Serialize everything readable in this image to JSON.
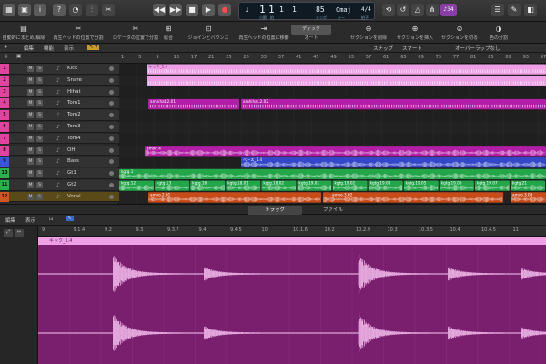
{
  "toolbar": {
    "lcd": {
      "bar": "1",
      "beat": "1",
      "div": "1",
      "tick": "1",
      "tempo": "85",
      "key": "Cmaj",
      "signature": "4/4",
      "labels": [
        "小節",
        "拍",
        "テンポ",
        "キー",
        "拍子"
      ]
    },
    "tuner_badge": "♪34",
    "icons": [
      "library-icon",
      "inbox-icon",
      "info-icon",
      "help-icon",
      "smart-controls-icon",
      "mixer-icon",
      "scissors-icon",
      "rewind-icon",
      "fast-forward-icon",
      "stop-icon",
      "play-icon",
      "record-icon",
      "cycle-icon",
      "undo-icon",
      "metronome-icon",
      "tuner-icon",
      "badge",
      "list-editor-icon",
      "notepad-icon",
      "browser-icon"
    ]
  },
  "controlbar": {
    "items": [
      "自動的にまとめ/解除",
      "再生ヘッドの位置で分割",
      "ロケータの位置で分割",
      "結合",
      "ジョインとバウンス",
      "再生ヘッドの位置に移動",
      "ディック",
      "オート",
      "セクションを削除",
      "セクションを挿入",
      "セクションを切る",
      "色の分割"
    ],
    "dropdown": "ディック"
  },
  "header": {
    "edit": "編集",
    "function": "機能",
    "view": "表示",
    "snap": "スナップ",
    "smart": "スマート",
    "overlap": "オーバーラップなし"
  },
  "tracks": [
    {
      "num": "1",
      "name": "Kick",
      "color": "#e0449e"
    },
    {
      "num": "2",
      "name": "Snare",
      "color": "#e0449e"
    },
    {
      "num": "3",
      "name": "Hihat",
      "color": "#e0449e"
    },
    {
      "num": "4",
      "name": "Tom1",
      "color": "#e0449e"
    },
    {
      "num": "5",
      "name": "Tom2",
      "color": "#e0449e"
    },
    {
      "num": "6",
      "name": "Tom3",
      "color": "#e0449e"
    },
    {
      "num": "7",
      "name": "Tom4",
      "color": "#e0449e"
    },
    {
      "num": "8",
      "name": "OH",
      "color": "#e0449e"
    },
    {
      "num": "9",
      "name": "Bass",
      "color": "#3a55d9"
    },
    {
      "num": "10",
      "name": "Gt1",
      "color": "#27b24e"
    },
    {
      "num": "11",
      "name": "Gt2",
      "color": "#27b24e"
    },
    {
      "num": "12",
      "name": "Vocal",
      "color": "#d0561e"
    }
  ],
  "track_buttons": {
    "mute": "M",
    "solo": "S"
  },
  "ruler": [
    "1",
    "5",
    "9",
    "13",
    "17",
    "21",
    "25",
    "29",
    "33",
    "37",
    "41",
    "45",
    "49",
    "53",
    "57",
    "61",
    "65",
    "69",
    "73",
    "77",
    "81",
    "85",
    "89",
    "93",
    "97"
  ],
  "regions": {
    "kick": "キック_1.4",
    "hihat1": "amhihat.2.01",
    "hihat2": "amhihat.2.02",
    "oh": "amoh.4",
    "bass": "ベース_1.4",
    "gt": "kgtg.1",
    "gt_parts": [
      "kgtg.12",
      "kgtg.13",
      "kgtg.16",
      "kgtg.18.01",
      "kgtg.18.02",
      "kgtg.19.01",
      "kgtg.19.02",
      "kgtg.19.03",
      "kgtg.19.05",
      "kgtg.19.06",
      "kgtg.19.07",
      "kgtg.21"
    ],
    "vocal": [
      "amvo.2.01",
      "amvo.2.02",
      "amvo.3.02",
      "amvo.3.03"
    ]
  },
  "tabs": {
    "track": "トラック",
    "file": "ファイル"
  },
  "editor": {
    "edit": "編集",
    "view": "表示",
    "ruler": [
      "9",
      "9.1.4",
      "9.2",
      "9.3",
      "9.3.7",
      "9.4",
      "9.4.5",
      "10",
      "10.1.6",
      "10.2",
      "10.2.9",
      "10.3",
      "10.3.5",
      "10.4",
      "10.4.5",
      "11"
    ],
    "region": "キック_1.4"
  }
}
